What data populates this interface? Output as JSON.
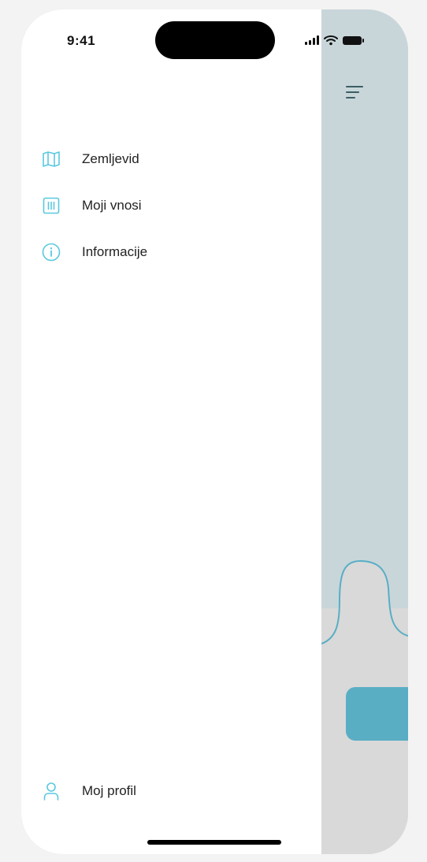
{
  "status_bar": {
    "time": "9:41",
    "signal_icon": "cellular-signal-icon",
    "wifi_icon": "wifi-icon",
    "battery_icon": "battery-icon"
  },
  "drawer": {
    "menu_items": [
      {
        "label": "Zemljevid",
        "icon": "map-icon"
      },
      {
        "label": "Moji vnosi",
        "icon": "entries-icon"
      },
      {
        "label": "Informacije",
        "icon": "info-icon"
      }
    ],
    "profile": {
      "label": "Moj profil",
      "icon": "user-icon"
    }
  },
  "background_app": {
    "menu_icon": "hamburger-menu-icon"
  },
  "colors": {
    "accent": "#5ac8e0",
    "background_app": "#c8d6da",
    "background_lower": "#d9d9d9",
    "button": "#5aaec4",
    "drawer": "#ffffff"
  }
}
